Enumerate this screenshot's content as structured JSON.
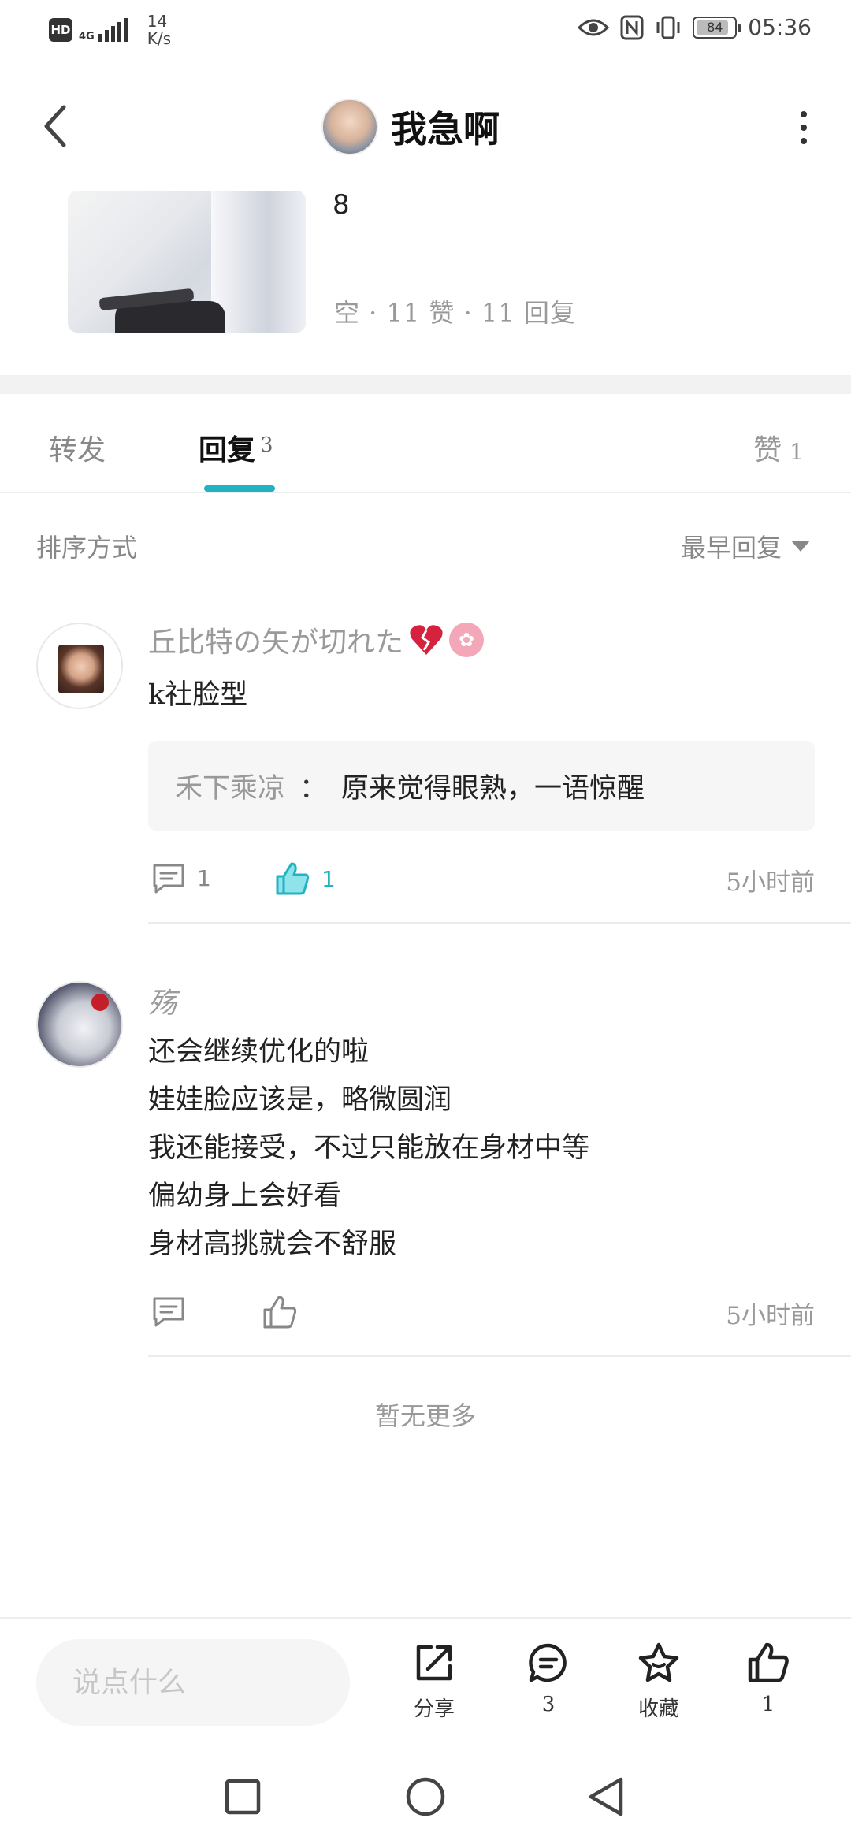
{
  "status_bar": {
    "hd": "HD",
    "signal_type": "4G",
    "net_speed_value": "14",
    "net_speed_unit": "K/s",
    "battery_level": "84",
    "time": "05:36"
  },
  "header": {
    "title": "我急啊"
  },
  "post": {
    "text": "8",
    "stats": "空 · 11 赞 · 11 回复"
  },
  "tabs": {
    "forward_label": "转发",
    "reply_label": "回复",
    "reply_count": "3",
    "like_label": "赞",
    "like_count": "1"
  },
  "sort": {
    "label": "排序方式",
    "selected": "最早回复"
  },
  "comments": [
    {
      "author": "丘比特の矢が切れた",
      "body_lines": [
        "k社脸型"
      ],
      "quote": {
        "author": "禾下乘凉",
        "separator": "：",
        "text": "原来觉得眼熟，一语惊醒"
      },
      "reply_count": "1",
      "like_count": "1",
      "time": "5小时前"
    },
    {
      "author": "殇",
      "body_lines": [
        "还会继续优化的啦",
        "娃娃脸应该是，略微圆润",
        "我还能接受，不过只能放在身材中等",
        "偏幼身上会好看",
        "身材高挑就会不舒服"
      ],
      "time": "5小时前"
    }
  ],
  "no_more": "暂无更多",
  "bottom_bar": {
    "input_placeholder": "说点什么",
    "share_label": "分享",
    "comments_count": "3",
    "fav_label": "收藏",
    "like_count": "1"
  },
  "colors": {
    "accent": "#21b3c1",
    "muted": "#999999",
    "text": "#222222"
  },
  "icons": [
    "back-arrow-icon",
    "more-vertical-icon",
    "broken-heart-icon",
    "comment-icon",
    "thumbs-up-icon",
    "share-icon",
    "star-icon",
    "nav-square-icon",
    "nav-home-icon",
    "nav-back-icon"
  ]
}
